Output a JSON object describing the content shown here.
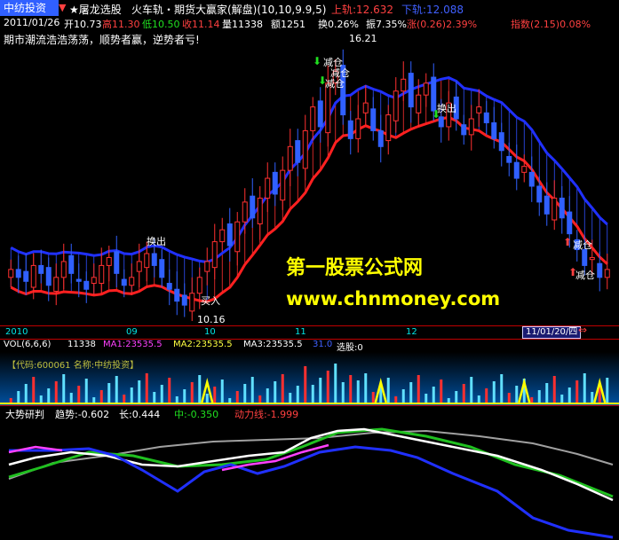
{
  "header": {
    "stock_name": "中纺投资",
    "menu_star": "★屠龙选股",
    "indicator_name": "火车轨・期货大赢家(解盘)(10,10,9.9,5)",
    "upper_label": "上轨:12.632",
    "lower_label": "下轨:12.088"
  },
  "quote": {
    "date": "2011/01/26",
    "open": "开10.73",
    "high": "高11.30",
    "low": "低10.50",
    "close": "收11.14",
    "volume": "量11338",
    "amount": "额1251",
    "turnover": "换0.26%",
    "amplitude": "振7.35%",
    "change": "涨(0.26)2.39%",
    "index": "指数(2.15)0.08%"
  },
  "motto": "期市潮流浩浩荡荡，顺势者赢，逆势者亏!",
  "chart_labels": {
    "high_price": "16.21",
    "low_price": "10.16",
    "reduce1": "减仓",
    "reduce2": "减仓",
    "reduce3": "减仓",
    "swap1": "换出",
    "swap2": "换出",
    "buy": "买入",
    "reduce4": "减仓",
    "reduce5": "减仓"
  },
  "watermark": {
    "title": "第一股票公式网",
    "url": "www.chnmoney.com"
  },
  "date_axis": {
    "y2010": "2010",
    "m09": "09",
    "m10": "10",
    "m11": "11",
    "m12": "12",
    "cursor_date": "11/01/20/四"
  },
  "volume_panel": {
    "label": "VOL(6,6,6)",
    "vol": "11338",
    "ma1": "MA1:23535.5",
    "ma2": "MA2:23535.5",
    "ma3": "MA3:23535.5",
    "extra": "31.0",
    "pick": "选股:0",
    "code_line": "【代码:600061 名称:中纺投资】"
  },
  "trend_panel": {
    "label": "大势研判",
    "trend": "趋势:-0.602",
    "long": "长:0.444",
    "mid": "中:-0.350",
    "power": "动力线:-1.999"
  },
  "colors": {
    "up_candle": "#ff3030",
    "down_candle": "#3060ff",
    "upper_band": "#2030ff",
    "lower_band": "#ff2020",
    "watermark": "#ffff00"
  },
  "chart_data": {
    "type": "candlestick",
    "y_high_label": 16.21,
    "y_low_label": 10.16,
    "closes": [
      11.1,
      10.9,
      10.8,
      11.2,
      11.0,
      10.7,
      10.9,
      11.3,
      11.0,
      10.8,
      10.6,
      10.9,
      11.2,
      11.4,
      11.0,
      10.7,
      10.9,
      11.3,
      11.5,
      11.2,
      10.9,
      10.6,
      10.3,
      10.2,
      10.5,
      10.9,
      11.3,
      11.8,
      12.1,
      11.7,
      12.3,
      12.8,
      12.4,
      12.9,
      13.4,
      13.0,
      13.6,
      14.2,
      13.8,
      14.6,
      15.2,
      14.7,
      15.8,
      16.1,
      15.0,
      14.4,
      14.9,
      15.3,
      14.6,
      14.2,
      15.0,
      15.6,
      15.9,
      15.2,
      15.5,
      15.8,
      15.1,
      14.7,
      15.3,
      14.9,
      14.5,
      14.9,
      15.2,
      14.8,
      14.4,
      14.1,
      13.8,
      13.4,
      13.7,
      13.2,
      12.8,
      12.5,
      12.9,
      12.4,
      12.0,
      11.6,
      11.2,
      11.4,
      10.9,
      11.1
    ]
  }
}
